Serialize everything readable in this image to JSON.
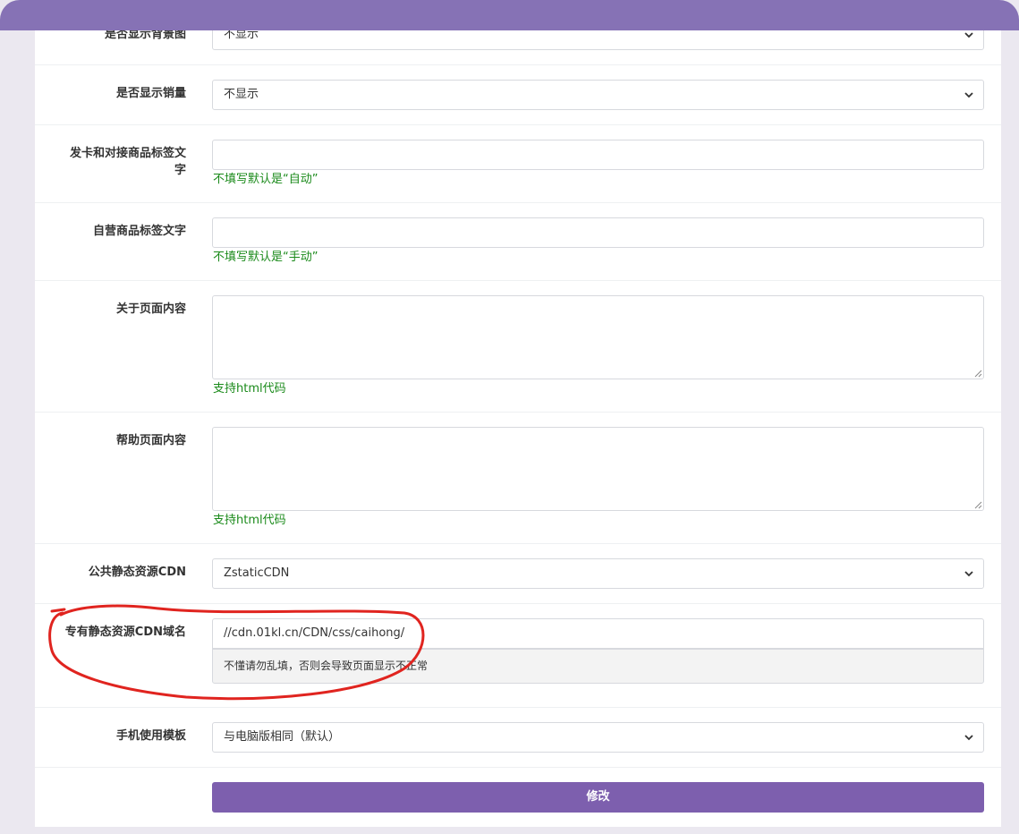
{
  "form": {
    "show_background": {
      "label": "是否显示背景图",
      "value": "不显示"
    },
    "show_sales": {
      "label": "是否显示销量",
      "value": "不显示"
    },
    "card_tag_text": {
      "label_line1": "发卡和对接商品标签文",
      "label_line2": "字",
      "value": "",
      "hint": "不填写默认是“自动”"
    },
    "self_tag_text": {
      "label": "自营商品标签文字",
      "value": "",
      "hint": "不填写默认是“手动”"
    },
    "about_content": {
      "label": "关于页面内容",
      "value": "",
      "hint": "支持html代码"
    },
    "help_content": {
      "label": "帮助页面内容",
      "value": "",
      "hint": "支持html代码"
    },
    "public_cdn": {
      "label": "公共静态资源CDN",
      "value": "ZstaticCDN"
    },
    "private_cdn": {
      "label": "专有静态资源CDN域名",
      "value": "//cdn.01kl.cn/CDN/css/caihong/",
      "warning": "不懂请勿乱填，否则会导致页面显示不正常"
    },
    "mobile_template": {
      "label": "手机使用模板",
      "value": "与电脑版相同（默认）"
    },
    "submit_label": "修改"
  },
  "colors": {
    "header": "#8672b5",
    "submit": "#7d5fae",
    "hint": "#1a8a1a",
    "annotation": "#e0241f"
  },
  "icons": [
    "chevron-down-icon",
    "resize-grip-icon"
  ]
}
